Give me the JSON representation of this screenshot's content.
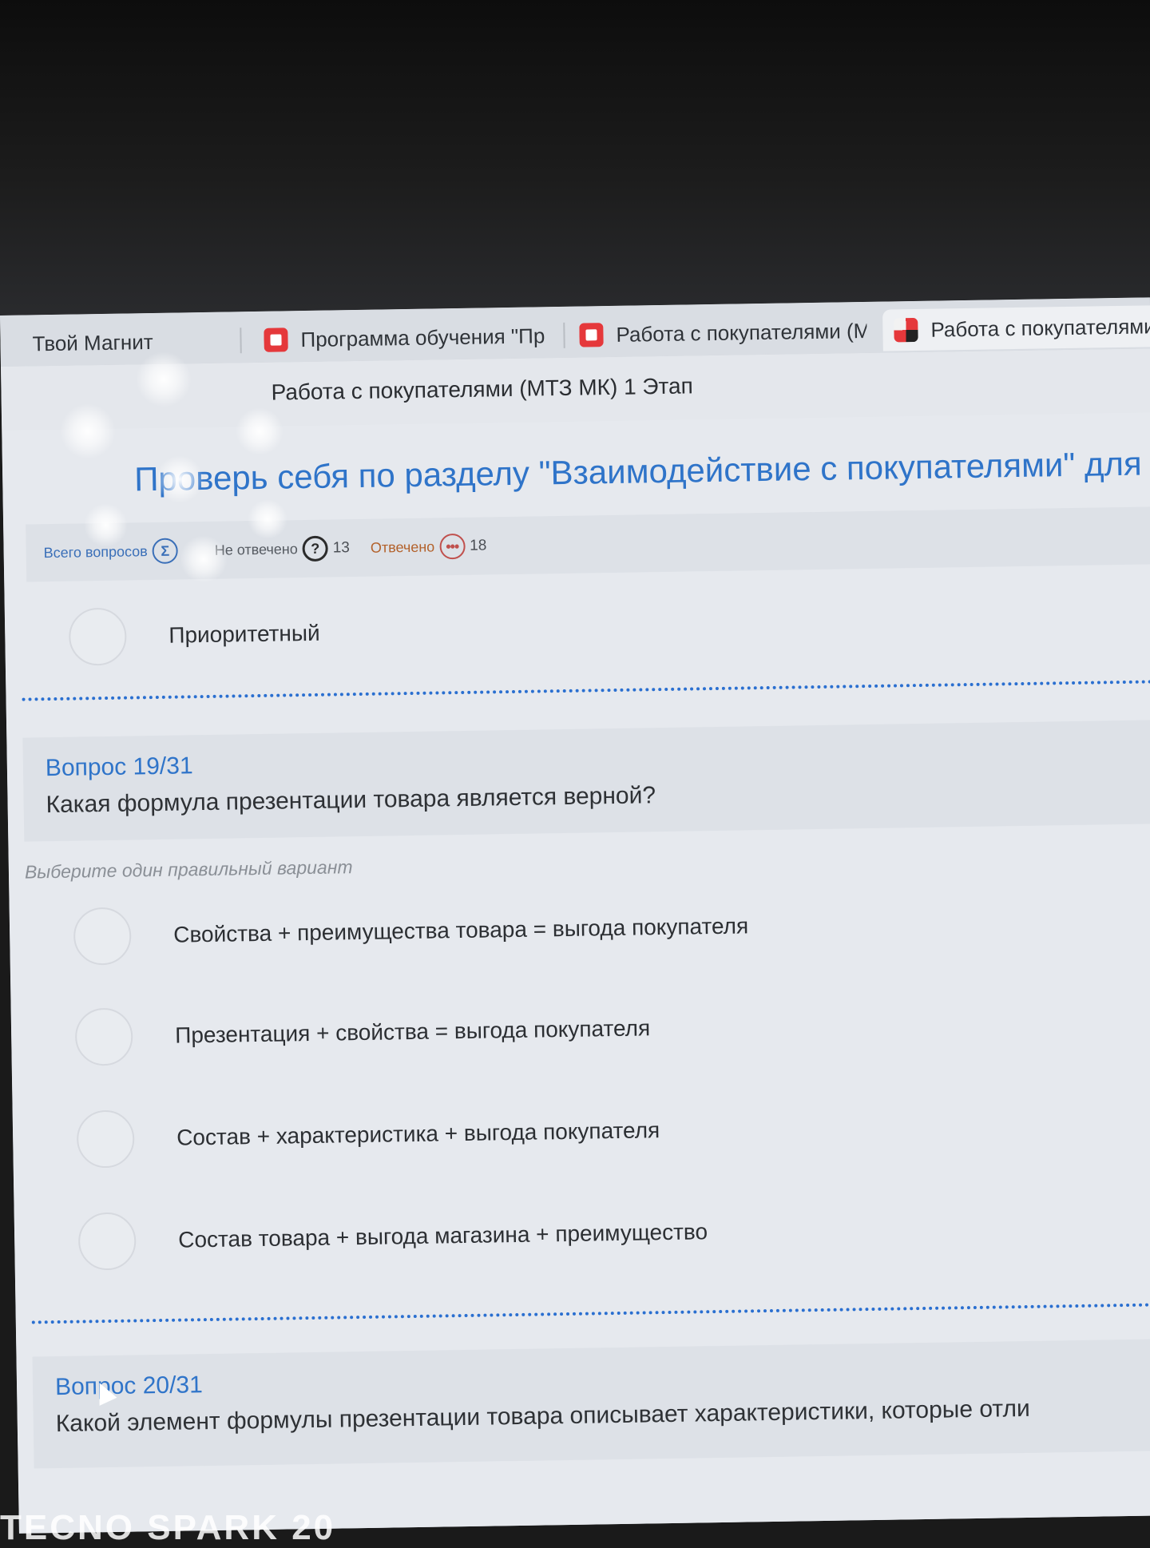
{
  "browser": {
    "tabs": [
      {
        "label": "Твой Магнит",
        "icon": "none"
      },
      {
        "label": "Программа обучения \"Пр",
        "icon": "magnit-red-icon"
      },
      {
        "label": "Работа с покупателями (М",
        "icon": "magnit-red-icon"
      },
      {
        "label": "Работа с покупателями",
        "icon": "mosaic-icon"
      }
    ]
  },
  "page": {
    "course_title": "Работа с покупателями (МТЗ МК) 1 Этап",
    "quiz_title": "Проверь себя по разделу \"Взаимодействие с покупателями\" для М"
  },
  "stats": {
    "total_label": "Всего вопросов",
    "total_symbol": "Σ",
    "unanswered_label": "Не отвечено",
    "unanswered_symbol": "?",
    "unanswered_count": "13",
    "answered_label": "Отвечено",
    "answered_symbol": "•••",
    "answered_count": "18"
  },
  "prev_answer": {
    "text": "Приоритетный"
  },
  "question19": {
    "number": "Вопрос 19/31",
    "text": "Какая формула презентации товара является верной?",
    "hint": "Выберите один правильный вариант",
    "options": [
      "Свойства + преимущества товара = выгода покупателя",
      "Презентация + свойства = выгода покупателя",
      "Состав + характеристика + выгода покупателя",
      "Состав товара + выгода магазина + преимущество"
    ]
  },
  "question20": {
    "number": "Вопрос 20/31",
    "text": "Какой элемент формулы презентации товара описывает характеристики, которые отли"
  },
  "watermark": "TECNO SPARK 20",
  "colors": {
    "accent": "#2f74c9",
    "divider": "#2a6fd0",
    "answered": "#c0504d"
  }
}
